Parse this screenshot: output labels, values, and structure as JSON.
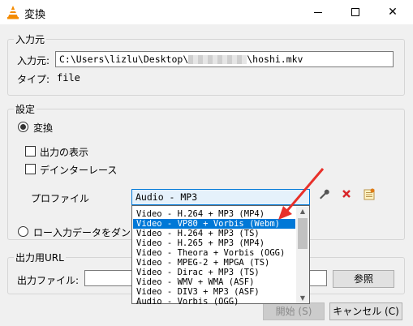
{
  "window": {
    "title": "変換",
    "minimize_icon": "minimize-icon",
    "maximize_icon": "maximize-icon",
    "close_icon": "close-icon"
  },
  "source": {
    "group_title": "入力元",
    "input_label": "入力元:",
    "path_prefix": "C:\\Users\\lizlu\\Desktop\\",
    "path_suffix": "\\hoshi.mkv",
    "type_label": "タイプ:",
    "type_value": "file"
  },
  "settings": {
    "group_title": "設定",
    "convert_label": "変換",
    "show_output_label": "出力の表示",
    "deinterlace_label": "デインターレース",
    "profile_label": "プロファイル",
    "profile_selected": "Audio - MP3",
    "dump_label": "ロー入力データをダン"
  },
  "profiles": [
    "Video - H.264 + MP3 (MP4)",
    "Video - VP80 + Vorbis (Webm)",
    "Video - H.264 + MP3 (TS)",
    "Video - H.265 + MP3 (MP4)",
    "Video - Theora + Vorbis (OGG)",
    "Video - MPEG-2 + MPGA (TS)",
    "Video - Dirac + MP3 (TS)",
    "Video - WMV + WMA (ASF)",
    "Video - DIV3 + MP3 (ASF)",
    "Audio - Vorbis (OGG)"
  ],
  "highlighted_profile_index": 1,
  "output": {
    "group_title": "出力用URL",
    "file_label": "出力ファイル:",
    "browse_label": "参照"
  },
  "footer": {
    "start_label": "開始 (S)",
    "cancel_label": "キャンセル (C)"
  },
  "colors": {
    "selection": "#0078d7",
    "arrow": "#e8302a",
    "delete_icon": "#d9262a"
  }
}
